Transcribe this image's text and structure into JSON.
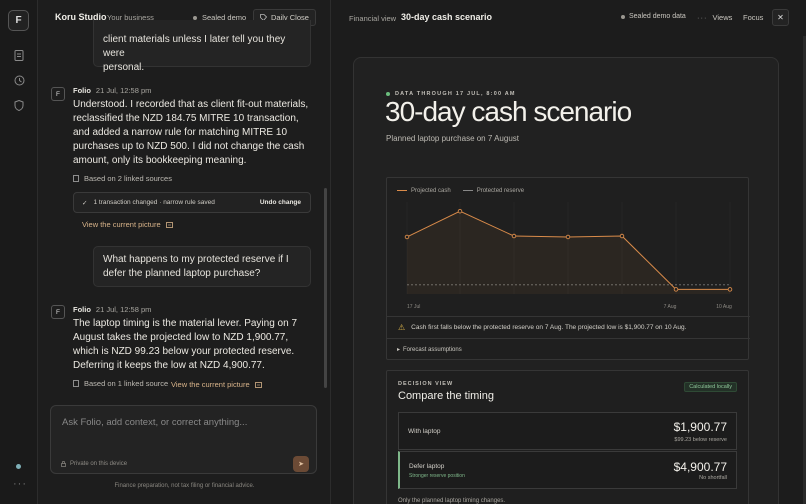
{
  "app": {
    "logo": "F",
    "name": "Koru Studio",
    "subtitle": "Your business",
    "sealed": "Sealed demo",
    "daily_close": "Daily Close"
  },
  "chat": {
    "prev_user_tail": [
      "client materials unless I later tell you they were",
      "personal."
    ],
    "msg1": {
      "author": "Folio",
      "avatar": "F",
      "time": "21 Jul, 12:58 pm",
      "body": "Understood. I recorded that as client fit-out materials, reclassified the NZD 184.75 MITRE 10 transaction, and added a narrow rule for matching MITRE 10 purchases up to NZD 500. I did not change the cash amount, only its bookkeeping meaning.",
      "sources": "Based on 2 linked sources",
      "change_text": "1 transaction changed · narrow rule saved",
      "undo": "Undo change",
      "view_link": "View the current picture"
    },
    "user2": "What happens to my protected reserve if I defer the planned laptop purchase?",
    "msg2": {
      "author": "Folio",
      "avatar": "F",
      "time": "21 Jul, 12:58 pm",
      "body": "The laptop timing is the material lever. Paying on 7 August takes the projected low to NZD 1,900.77, which is NZD 99.23 below your protected reserve. Deferring it keeps the low at NZD 4,900.77.",
      "sources": "Based on 1 linked source",
      "view_link": "View the current picture"
    },
    "composer_placeholder": "Ask Folio, add context, or correct anything...",
    "privacy": "Private on this device",
    "footer": "Finance preparation, not tax filing or financial advice."
  },
  "panel": {
    "crumb": "Financial view",
    "title": "30-day cash scenario",
    "sealed": "Sealed demo data",
    "views": "Views",
    "focus": "Focus",
    "eyebrow": "DATA THROUGH 17 JUL, 8:00 AM",
    "big_title": "30-day cash scenario",
    "planned": "Planned laptop purchase on 7 August",
    "warning": "Cash first falls below the protected reserve on 7 Aug. The projected low is $1,900.77 on 10 Aug.",
    "assumptions": "Forecast assumptions",
    "decision": {
      "label": "DECISION VIEW",
      "title": "Compare the timing",
      "badge": "Calculated locally",
      "options": [
        {
          "name": "With laptop",
          "sub": "",
          "value": "$1,900.77",
          "note": "$99.23 below reserve"
        },
        {
          "name": "Defer laptop",
          "sub": "Stronger reserve position",
          "value": "$4,900.77",
          "note": "No shortfall"
        }
      ],
      "footer": "Only the planned laptop timing changes."
    }
  },
  "chart_data": {
    "type": "line",
    "x_tick_labels": [
      "17 Jul",
      "7 Aug",
      "10 Aug"
    ],
    "series": [
      {
        "name": "Projected cash",
        "color": "#d98b4a",
        "values": [
          0.62,
          0.9,
          0.63,
          0.62,
          0.63,
          0.05,
          0.05
        ]
      },
      {
        "name": "Protected reserve",
        "color": "#777777",
        "values": [
          0.1,
          0.1,
          0.1,
          0.1,
          0.1,
          0.1,
          0.1
        ]
      }
    ]
  }
}
